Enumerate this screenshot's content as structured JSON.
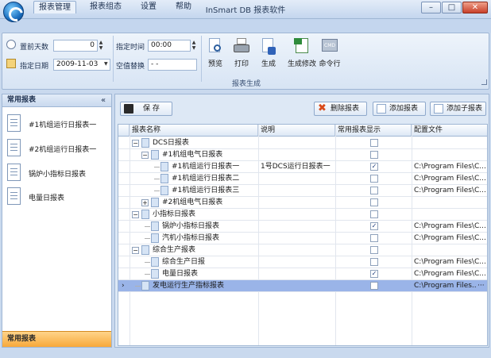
{
  "window": {
    "title": "InSmart DB 报表软件",
    "minimize": "–",
    "maximize": "□",
    "close": "✕"
  },
  "menu_tabs": [
    "报表管理",
    "报表组态",
    "设置",
    "帮助"
  ],
  "ribbon": {
    "days_ahead_label": "置前天数",
    "days_ahead_value": "0",
    "fixed_date_label": "指定日期",
    "fixed_date_value": "2009-11-03",
    "fixed_time_label": "指定时间",
    "fixed_time_value": "00:00",
    "null_replace_label": "空值替换",
    "null_replace_value": "- -",
    "buttons": [
      "预览",
      "打印",
      "生成",
      "生成修改",
      "命令行"
    ],
    "group_label": "报表生成"
  },
  "left_panel": {
    "header": "常用报表",
    "collapse": "«",
    "items": [
      "#1机组运行日报表一",
      "#2机组运行日报表一",
      "锅炉小指标日报表",
      "电量日报表"
    ],
    "footer": "常用报表"
  },
  "toolbar": {
    "save": "保  存",
    "delete": "删除报表",
    "add": "添加报表",
    "add_child": "添加子报表"
  },
  "grid": {
    "columns": [
      "报表名称",
      "说明",
      "常用报表显示",
      "配置文件"
    ],
    "rows": [
      {
        "name": "DCS日报表",
        "desc": "",
        "checked": false,
        "file": ""
      },
      {
        "name": "#1机组电气日报表",
        "desc": "",
        "checked": false,
        "file": ""
      },
      {
        "name": "#1机组运行日报表一",
        "desc": "1号DCS运行日报表一",
        "checked": true,
        "file": "C:\\Program Files\\C..."
      },
      {
        "name": "#1机组运行日报表二",
        "desc": "",
        "checked": false,
        "file": "C:\\Program Files\\C..."
      },
      {
        "name": "#1机组运行日报表三",
        "desc": "",
        "checked": false,
        "file": "C:\\Program Files\\C..."
      },
      {
        "name": "#2机组电气日报表",
        "desc": "",
        "checked": false,
        "file": ""
      },
      {
        "name": "小指标日报表",
        "desc": "",
        "checked": false,
        "file": ""
      },
      {
        "name": "锅炉小指标日报表",
        "desc": "",
        "checked": true,
        "file": "C:\\Program Files\\C..."
      },
      {
        "name": "汽机小指标日报表",
        "desc": "",
        "checked": false,
        "file": "C:\\Program Files\\C..."
      },
      {
        "name": "综合生产报表",
        "desc": "",
        "checked": false,
        "file": ""
      },
      {
        "name": "综合生产日报",
        "desc": "",
        "checked": false,
        "file": "C:\\Program Files\\C..."
      },
      {
        "name": "电量日报表",
        "desc": "",
        "checked": true,
        "file": "C:\\Program Files\\C..."
      },
      {
        "name": "发电运行生产指标报表",
        "desc": "",
        "checked": false,
        "file": "C:\\Program Files..."
      }
    ],
    "ellipsis": "···",
    "row_pointer": "›"
  }
}
